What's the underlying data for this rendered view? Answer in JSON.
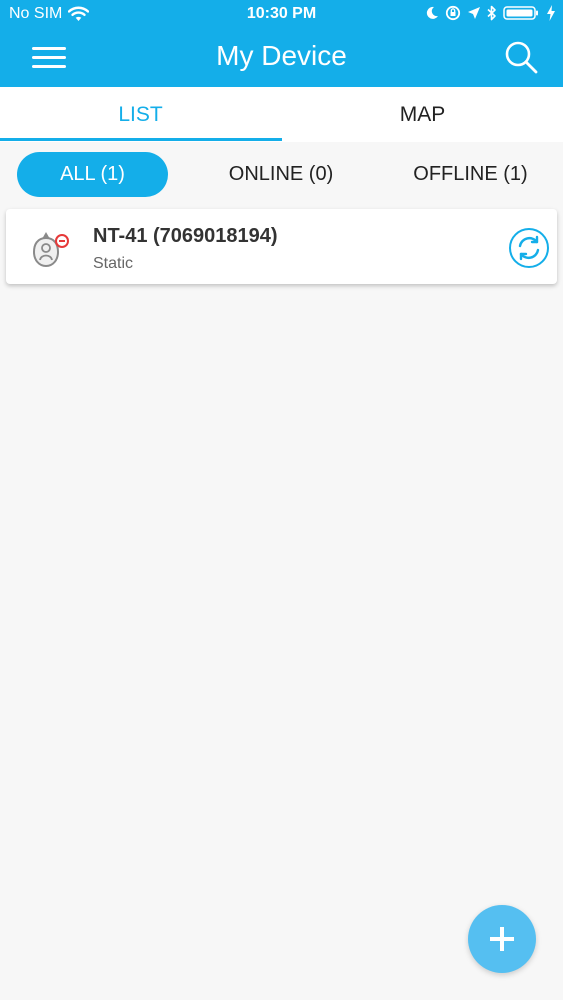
{
  "status_bar": {
    "carrier": "No SIM",
    "time": "10:30 PM"
  },
  "header": {
    "title": "My Device"
  },
  "tabs": [
    {
      "label": "LIST"
    },
    {
      "label": "MAP"
    }
  ],
  "filters": [
    {
      "label": "ALL (1)"
    },
    {
      "label": "ONLINE (0)"
    },
    {
      "label": "OFFLINE (1)"
    }
  ],
  "devices": [
    {
      "name": "NT-41 (7069018194)",
      "status": "Static"
    }
  ],
  "colors": {
    "accent": "#14aee9",
    "fab": "#55bff1",
    "background": "#f7f7f7"
  },
  "icons": {
    "menu": "hamburger-menu",
    "search": "search-magnifier",
    "device": "device-tracker",
    "refresh": "refresh-circle",
    "add": "plus"
  }
}
